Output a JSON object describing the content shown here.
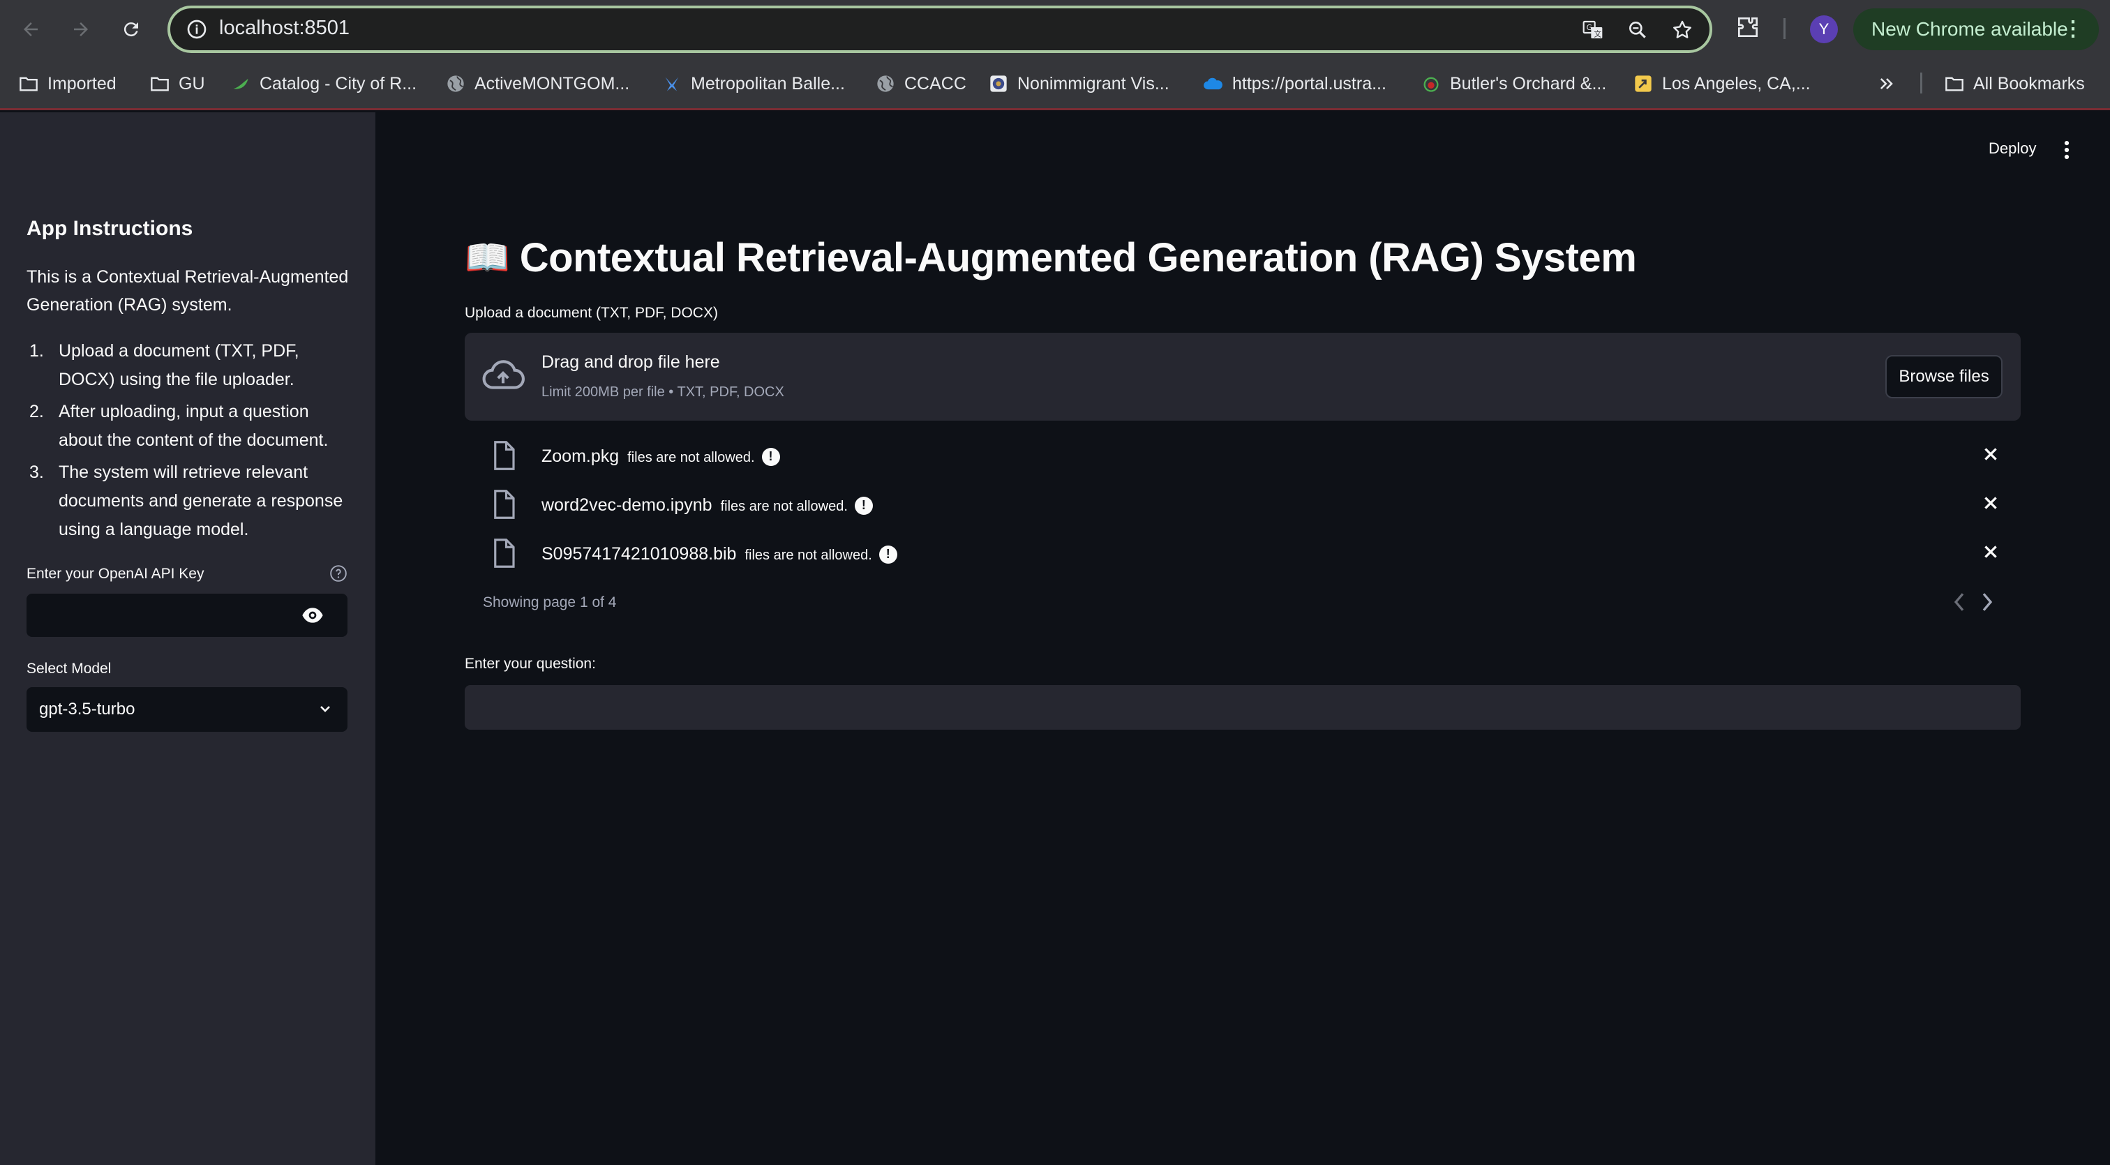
{
  "browser": {
    "url": "localhost:8501",
    "new_chrome_label": "New Chrome available",
    "avatar_letter": "Y",
    "bookmarks": [
      {
        "label": "Imported",
        "icon": "folder-icon"
      },
      {
        "label": "GU",
        "icon": "folder-icon"
      },
      {
        "label": "Catalog - City of R...",
        "icon": "leaf-icon"
      },
      {
        "label": "ActiveMONTGOM...",
        "icon": "globe-icon"
      },
      {
        "label": "Metropolitan Balle...",
        "icon": "star-icon"
      },
      {
        "label": "CCACC",
        "icon": "globe-icon"
      },
      {
        "label": "Nonimmigrant Vis...",
        "icon": "seal-icon"
      },
      {
        "label": "https://portal.ustra...",
        "icon": "cloud-icon"
      },
      {
        "label": "Butler's Orchard &...",
        "icon": "apple-icon"
      },
      {
        "label": "Los Angeles, CA,...",
        "icon": "tag-icon"
      }
    ],
    "all_bookmarks_label": "All Bookmarks"
  },
  "sidebar": {
    "title": "App Instructions",
    "intro": "This is a Contextual Retrieval-Augmented Generation (RAG) system.",
    "steps": [
      {
        "num": "1.",
        "text": "Upload a document (TXT, PDF, DOCX) using the file uploader."
      },
      {
        "num": "2.",
        "text": "After uploading, input a question about the content of the document."
      },
      {
        "num": "3.",
        "text": "The system will retrieve relevant documents and generate a response using a language model."
      }
    ],
    "api_key_label": "Enter your OpenAI API Key",
    "api_key_value": "",
    "model_label": "Select Model",
    "model_value": "gpt-3.5-turbo"
  },
  "main": {
    "deploy_label": "Deploy",
    "title_emoji": "📖",
    "title": "Contextual Retrieval-Augmented Generation (RAG) System",
    "upload_label": "Upload a document (TXT, PDF, DOCX)",
    "dropzone_main": "Drag and drop file here",
    "dropzone_sub": "Limit 200MB per file • TXT, PDF, DOCX",
    "browse_label": "Browse files",
    "files": [
      {
        "name": "Zoom.pkg",
        "error": "files are not allowed."
      },
      {
        "name": "word2vec-demo.ipynb",
        "error": "files are not allowed."
      },
      {
        "name": "S0957417421010988.bib",
        "error": "files are not allowed."
      }
    ],
    "pager_text": "Showing page 1 of 4",
    "question_label": "Enter your question:",
    "question_value": ""
  },
  "colors": {
    "app_bg": "#0e1117",
    "sidebar_bg": "#262730",
    "browser_chrome": "#35363a",
    "omnibox_border": "#a8c7a0"
  }
}
